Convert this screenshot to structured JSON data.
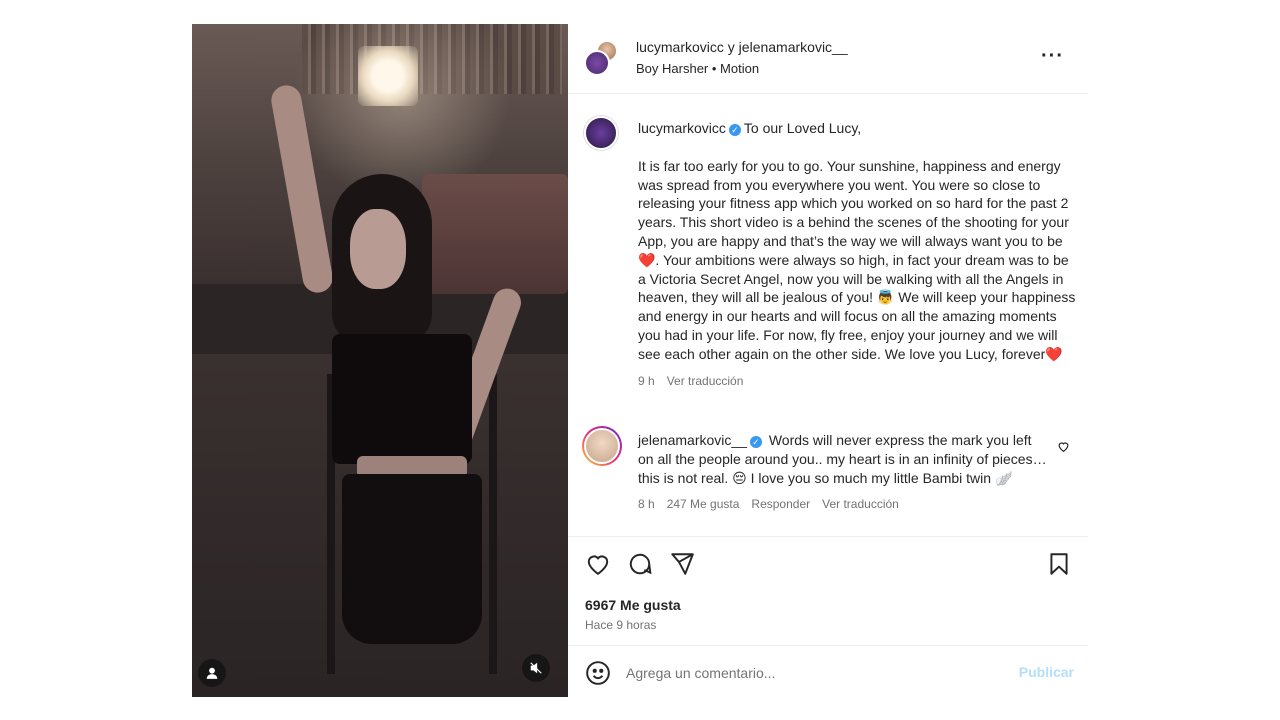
{
  "header": {
    "title": "lucymarkovicc y jelenamarkovic__",
    "subtitle": "Boy Harsher • Motion",
    "more_icon": "more-horizontal-icon"
  },
  "caption": {
    "username": "lucymarkovicc",
    "verified": true,
    "first_line": "To our Loved Lucy,",
    "body": "It is far too early for you to go. Your sunshine, happiness and energy was spread from you everywhere you went. You were so close to releasing your fitness app which you worked on so hard for the past 2 years. This short video is a behind the scenes of the shooting for your App, you are happy and that’s the way we will always want you to be❤️. Your ambitions were always so high, in fact your dream was to be a Victoria Secret Angel, now you will be walking with all the Angels in heaven, they will all be jealous of you! 👼 We will keep your happiness and energy in our hearts and will focus on all the amazing moments you had in your life. For now, fly free, enjoy your journey and we will see each other again on the other side. We love you Lucy, forever❤️",
    "time": "9 h",
    "translate_label": "Ver traducción"
  },
  "comment": {
    "username": "jelenamarkovic__",
    "verified": true,
    "text": "Words will never express the mark you left on all the people around you.. my heart is in an infinity of pieces… this is not real. 😔 I love you so much my little Bambi twin 🪽",
    "time": "8 h",
    "likes": "247 Me gusta",
    "reply_label": "Responder",
    "translate_label": "Ver traducción"
  },
  "actions": {
    "likes_count": "6967 Me gusta",
    "posted_ago": "Hace 9 horas"
  },
  "add_comment": {
    "placeholder": "Agrega un comentario...",
    "publish_label": "Publicar"
  },
  "colors": {
    "verified": "#3897f0",
    "muted_text": "#737373",
    "publish_disabled": "#b2dffc"
  }
}
